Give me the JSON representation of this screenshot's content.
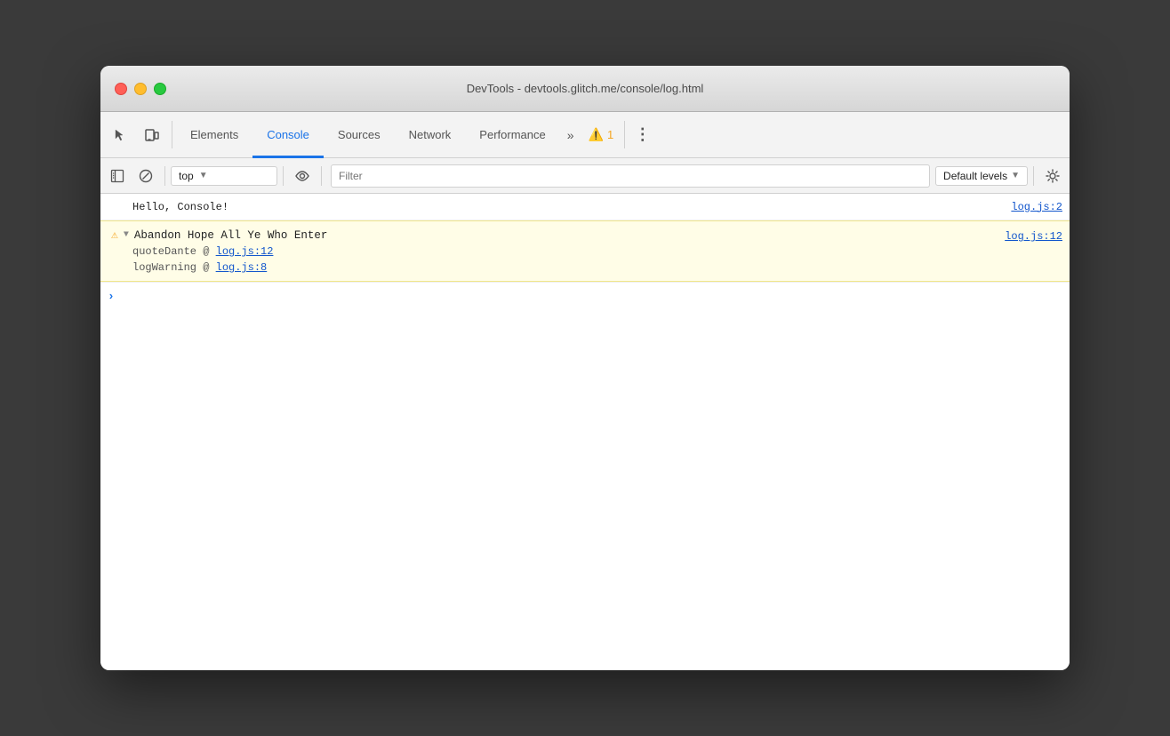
{
  "window": {
    "title": "DevTools - devtools.glitch.me/console/log.html"
  },
  "tabs": {
    "items": [
      {
        "id": "elements",
        "label": "Elements",
        "active": false
      },
      {
        "id": "console",
        "label": "Console",
        "active": true
      },
      {
        "id": "sources",
        "label": "Sources",
        "active": false
      },
      {
        "id": "network",
        "label": "Network",
        "active": false
      },
      {
        "id": "performance",
        "label": "Performance",
        "active": false
      }
    ],
    "overflow_label": "»",
    "warning_count": "1",
    "more_label": "⋮"
  },
  "console_toolbar": {
    "context_value": "top",
    "context_arrow": "▼",
    "filter_placeholder": "Filter",
    "levels_label": "Default levels",
    "levels_arrow": "▼"
  },
  "console_output": {
    "log_entry": {
      "text": "Hello, Console!",
      "link": "log.js:2"
    },
    "warning_entry": {
      "title": "Abandon Hope All Ye Who Enter",
      "link": "log.js:12",
      "stack": [
        {
          "fn": "quoteDante",
          "at": "@",
          "link": "log.js:12"
        },
        {
          "fn": "logWarning",
          "at": "@",
          "link": "log.js:8"
        }
      ]
    }
  },
  "colors": {
    "active_tab": "#1a73e8",
    "warning_bg": "#fffde7",
    "warning_icon": "#f5a623",
    "link": "#1155cc"
  }
}
